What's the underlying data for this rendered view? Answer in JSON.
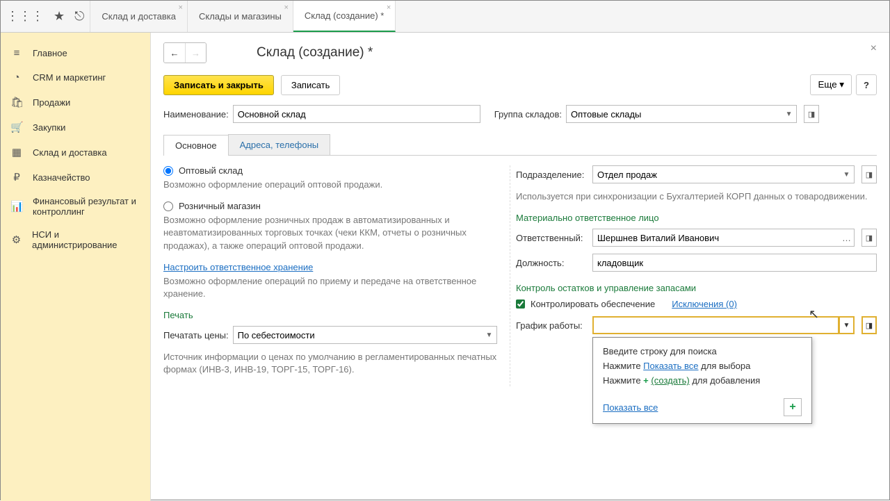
{
  "topbar": {
    "tabs": [
      {
        "label": "Склад и доставка"
      },
      {
        "label": "Склады и магазины"
      },
      {
        "label": "Склад (создание) *"
      }
    ]
  },
  "sidebar": {
    "items": [
      {
        "icon": "≡",
        "label": "Главное"
      },
      {
        "icon": "◔",
        "label": "CRM и маркетинг"
      },
      {
        "icon": "🛍",
        "label": "Продажи"
      },
      {
        "icon": "🛒",
        "label": "Закупки"
      },
      {
        "icon": "▦",
        "label": "Склад и доставка"
      },
      {
        "icon": "₽",
        "label": "Казначейство"
      },
      {
        "icon": "📊",
        "label": "Финансовый результат и контроллинг"
      },
      {
        "icon": "⚙",
        "label": "НСИ и администрирование"
      }
    ]
  },
  "page": {
    "title": "Склад (создание) *",
    "close": "×"
  },
  "toolbar": {
    "save_close": "Записать и закрыть",
    "save": "Записать",
    "more": "Еще ▾",
    "help": "?"
  },
  "header_fields": {
    "name_label": "Наименование:",
    "name_value": "Основной склад",
    "group_label": "Группа складов:",
    "group_value": "Оптовые склады"
  },
  "tabs": {
    "main": "Основное",
    "addresses": "Адреса, телефоны"
  },
  "left": {
    "wholesale": "Оптовый склад",
    "wholesale_hint": "Возможно оформление операций оптовой продажи.",
    "retail": "Розничный магазин",
    "retail_hint": "Возможно оформление розничных продаж в автоматизированных и неавтоматизированных торговых точках (чеки ККМ, отчеты о розничных продажах), а также операций оптовой продажи.",
    "custody_link": "Настроить ответственное хранение",
    "custody_hint": "Возможно оформление операций по приему и передаче на ответственное хранение.",
    "print_title": "Печать",
    "print_label": "Печатать цены:",
    "print_value": "По себестоимости",
    "print_hint": "Источник информации о ценах по умолчанию в регламентированных печатных формах (ИНВ-3, ИНВ-19, ТОРГ-15, ТОРГ-16)."
  },
  "right": {
    "division_label": "Подразделение:",
    "division_value": "Отдел продаж",
    "division_hint": "Используется при синхронизации с Бухгалтерией КОРП данных о товародвижении.",
    "resp_section": "Материально ответственное лицо",
    "resp_label": "Ответственный:",
    "resp_value": "Шершнев Виталий Иванович",
    "position_label": "Должность:",
    "position_value": "кладовщик",
    "stock_section": "Контроль остатков и управление запасами",
    "control_check": "Контролировать обеспечение",
    "exceptions": "Исключения (0)",
    "schedule_label": "График работы:",
    "schedule_value": ""
  },
  "popup": {
    "line1": "Введите строку для поиска",
    "line2_prefix": "Нажмите ",
    "line2_link": "Показать все",
    "line2_suffix": " для выбора",
    "line3_prefix": "Нажмите ",
    "line3_plus": "+",
    "line3_link": "(создать)",
    "line3_suffix": " для добавления",
    "footer_link": "Показать все"
  }
}
